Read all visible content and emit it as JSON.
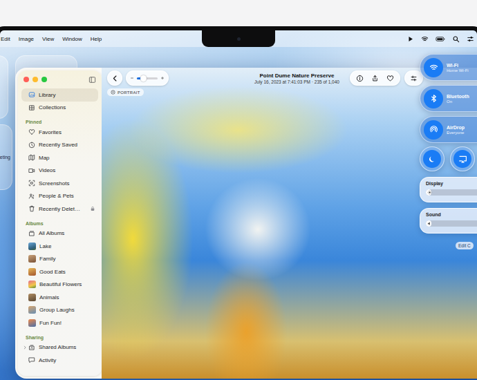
{
  "menu_bar": {
    "menus": [
      "Edit",
      "Image",
      "View",
      "Window",
      "Help"
    ]
  },
  "desktop_widget": {
    "text": "eting"
  },
  "photos": {
    "sidebar": {
      "top_items": [
        {
          "label": "Library",
          "kind": "icon",
          "selected": true,
          "locked": false
        },
        {
          "label": "Collections",
          "kind": "icon",
          "selected": false,
          "locked": false
        }
      ],
      "sections": [
        {
          "title": "Pinned",
          "items": [
            {
              "label": "Favorites",
              "kind": "icon",
              "selected": false,
              "locked": false
            },
            {
              "label": "Recently Saved",
              "kind": "icon",
              "selected": false,
              "locked": false
            },
            {
              "label": "Map",
              "kind": "icon",
              "selected": false,
              "locked": false
            },
            {
              "label": "Videos",
              "kind": "icon",
              "selected": false,
              "locked": false
            },
            {
              "label": "Screenshots",
              "kind": "icon",
              "selected": false,
              "locked": false
            },
            {
              "label": "People & Pets",
              "kind": "icon",
              "selected": false,
              "locked": false
            },
            {
              "label": "Recently Delet…",
              "kind": "icon",
              "selected": false,
              "locked": true
            }
          ]
        },
        {
          "title": "Albums",
          "items": [
            {
              "label": "All Albums",
              "kind": "icon",
              "selected": false,
              "locked": false
            },
            {
              "label": "Lake",
              "kind": "album",
              "selected": false,
              "locked": false
            },
            {
              "label": "Family",
              "kind": "album",
              "selected": false,
              "locked": false
            },
            {
              "label": "Good Eats",
              "kind": "album",
              "selected": false,
              "locked": false
            },
            {
              "label": "Beautiful Flowers",
              "kind": "album",
              "selected": false,
              "locked": false
            },
            {
              "label": "Animals",
              "kind": "album",
              "selected": false,
              "locked": false
            },
            {
              "label": "Group Laughs",
              "kind": "album",
              "selected": false,
              "locked": false
            },
            {
              "label": "Fun Fun!",
              "kind": "album",
              "selected": false,
              "locked": false
            }
          ]
        },
        {
          "title": "Sharing",
          "items": [
            {
              "label": "Shared Albums",
              "kind": "icon",
              "selected": false,
              "locked": false,
              "expanded": false
            },
            {
              "label": "Activity",
              "kind": "icon",
              "selected": false,
              "locked": false
            }
          ]
        }
      ]
    },
    "toolbar": {
      "title": "Point Dume Nature Preserve",
      "subtitle": "July 16, 2023 at 7:41:03 PM · 235 of 1,040",
      "zoom": {
        "level": 0.3
      },
      "favorite": false
    },
    "photo": {
      "badge": "PORTRAIT"
    }
  },
  "control_center": {
    "tiles": [
      {
        "title": "Wi-Fi",
        "subtitle": "Home Wi-Fi",
        "on": true
      },
      {
        "title": "Bluetooth",
        "subtitle": "On",
        "on": true
      },
      {
        "title": "AirDrop",
        "subtitle": "Everyone",
        "on": true
      }
    ],
    "buttons": [
      {
        "on": true
      },
      {
        "on": true
      }
    ],
    "sliders": [
      {
        "label": "Display",
        "level": 0.08
      },
      {
        "label": "Sound",
        "level": 0.08
      }
    ],
    "edit_button": "Edit C"
  }
}
